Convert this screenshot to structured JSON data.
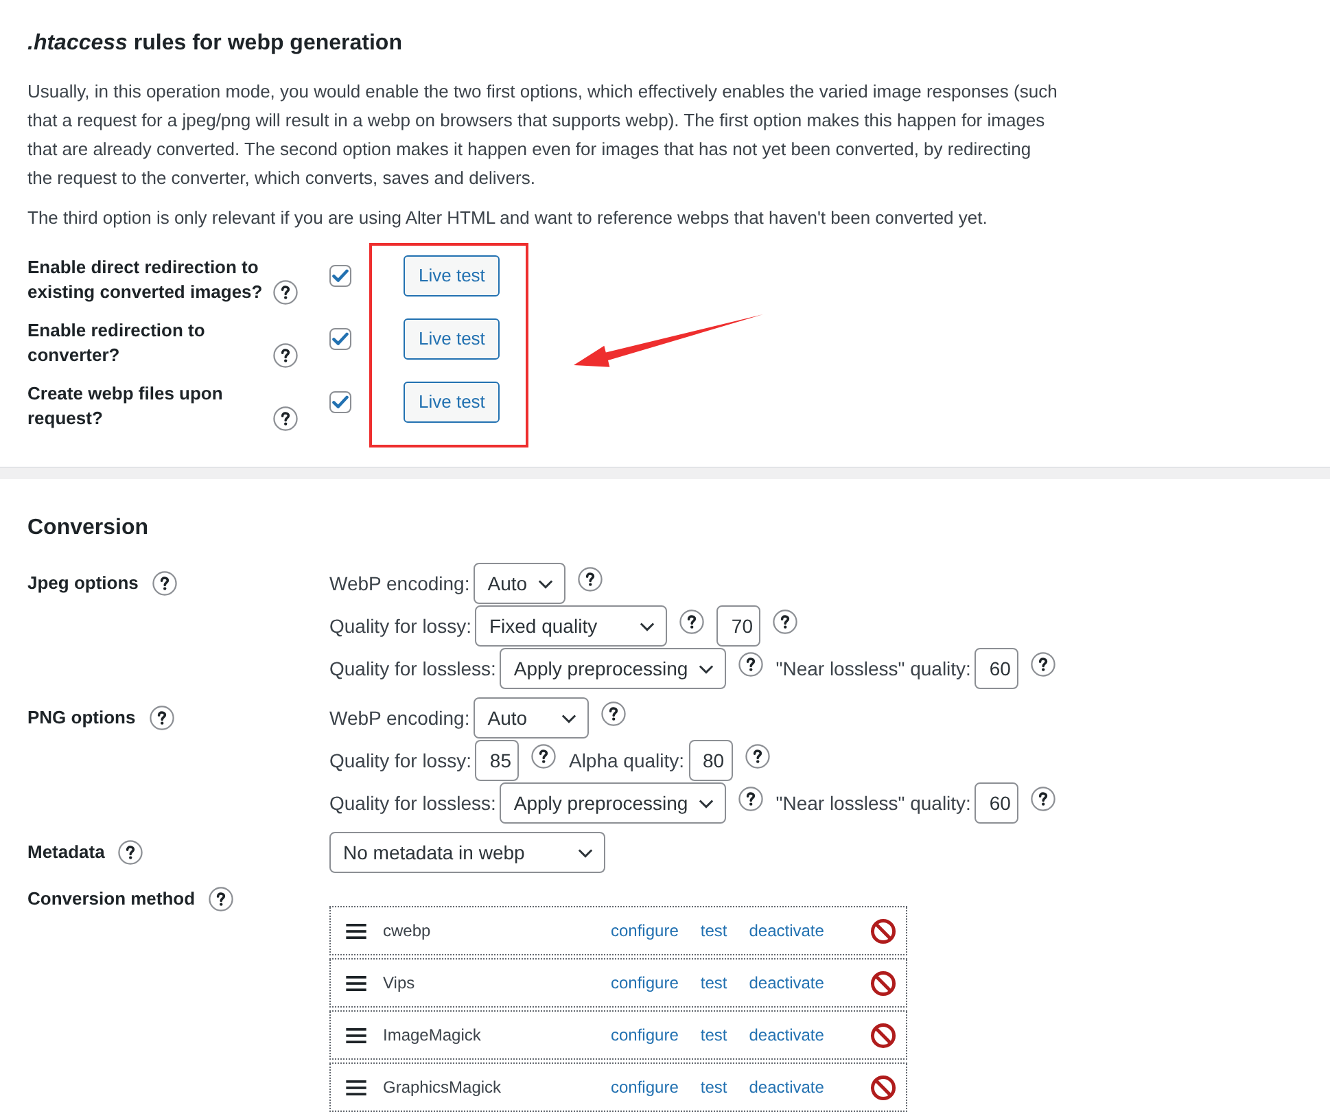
{
  "htaccess": {
    "title": "*.htaccess* rules for webp generation",
    "paragraphs": [
      "Usually, in this operation mode, you would enable the two first options, which effectively enables the varied image responses (such that a request for a jpeg/png will result in a webp on browsers that supports webp). The first option makes this happen for images that are already converted. The second option makes it happen even for images that has not yet been converted, by redirecting the request to the converter, which converts, saves and delivers.",
      "The third option is only relevant if you are using Alter HTML and want to reference webps that haven't been converted yet."
    ],
    "options": [
      {
        "label": "Enable direct redirection to existing converted images?",
        "checked": true,
        "button": "Live test"
      },
      {
        "label": "Enable redirection to converter?",
        "checked": true,
        "button": "Live test"
      },
      {
        "label": "Create webp files upon request?",
        "checked": true,
        "button": "Live test"
      }
    ]
  },
  "conversion": {
    "title": "Conversion",
    "settings": [
      {
        "label": "Jpeg options",
        "lines": [
          [
            {
              "kind": "text",
              "text": "WebP encoding:"
            },
            {
              "kind": "select",
              "value": "Auto"
            },
            {
              "kind": "help"
            }
          ],
          [
            {
              "kind": "text",
              "text": "Quality for lossy:"
            },
            {
              "kind": "select",
              "value": "Fixed quality"
            },
            {
              "kind": "help"
            },
            {
              "kind": "number",
              "value": "70"
            },
            {
              "kind": "help"
            }
          ],
          [
            {
              "kind": "text",
              "text": "Quality for lossless:"
            },
            {
              "kind": "select",
              "value": "Apply preprocessing"
            },
            {
              "kind": "help"
            },
            {
              "kind": "text",
              "text": "\"Near lossless\" quality:"
            },
            {
              "kind": "number",
              "value": "60"
            },
            {
              "kind": "help"
            }
          ]
        ]
      },
      {
        "label": "PNG options",
        "lines": [
          [
            {
              "kind": "text",
              "text": "WebP encoding:"
            },
            {
              "kind": "select",
              "value": "Auto"
            },
            {
              "kind": "help"
            }
          ],
          [
            {
              "kind": "text",
              "text": "Quality for lossy:"
            },
            {
              "kind": "number",
              "value": "85"
            },
            {
              "kind": "help"
            },
            {
              "kind": "text",
              "text": "Alpha quality:"
            },
            {
              "kind": "number",
              "value": "80"
            },
            {
              "kind": "help"
            }
          ],
          [
            {
              "kind": "text",
              "text": "Quality for lossless:"
            },
            {
              "kind": "select",
              "value": "Apply preprocessing"
            },
            {
              "kind": "help"
            },
            {
              "kind": "text",
              "text": "\"Near lossless\" quality:"
            },
            {
              "kind": "number",
              "value": "60"
            },
            {
              "kind": "help"
            }
          ]
        ]
      },
      {
        "label": "Metadata",
        "lines": [
          [
            {
              "kind": "select",
              "value": "No metadata in webp"
            }
          ]
        ]
      }
    ],
    "conversion_method": {
      "label": "Conversion method",
      "converters": [
        {
          "name": "cwebp",
          "links": [
            "configure",
            "test",
            "deactivate"
          ]
        },
        {
          "name": "Vips",
          "links": [
            "configure",
            "test",
            "deactivate"
          ]
        },
        {
          "name": "ImageMagick",
          "links": [
            "configure",
            "test",
            "deactivate"
          ]
        },
        {
          "name": "GraphicsMagick",
          "links": [
            "configure",
            "test",
            "deactivate"
          ]
        }
      ]
    }
  }
}
